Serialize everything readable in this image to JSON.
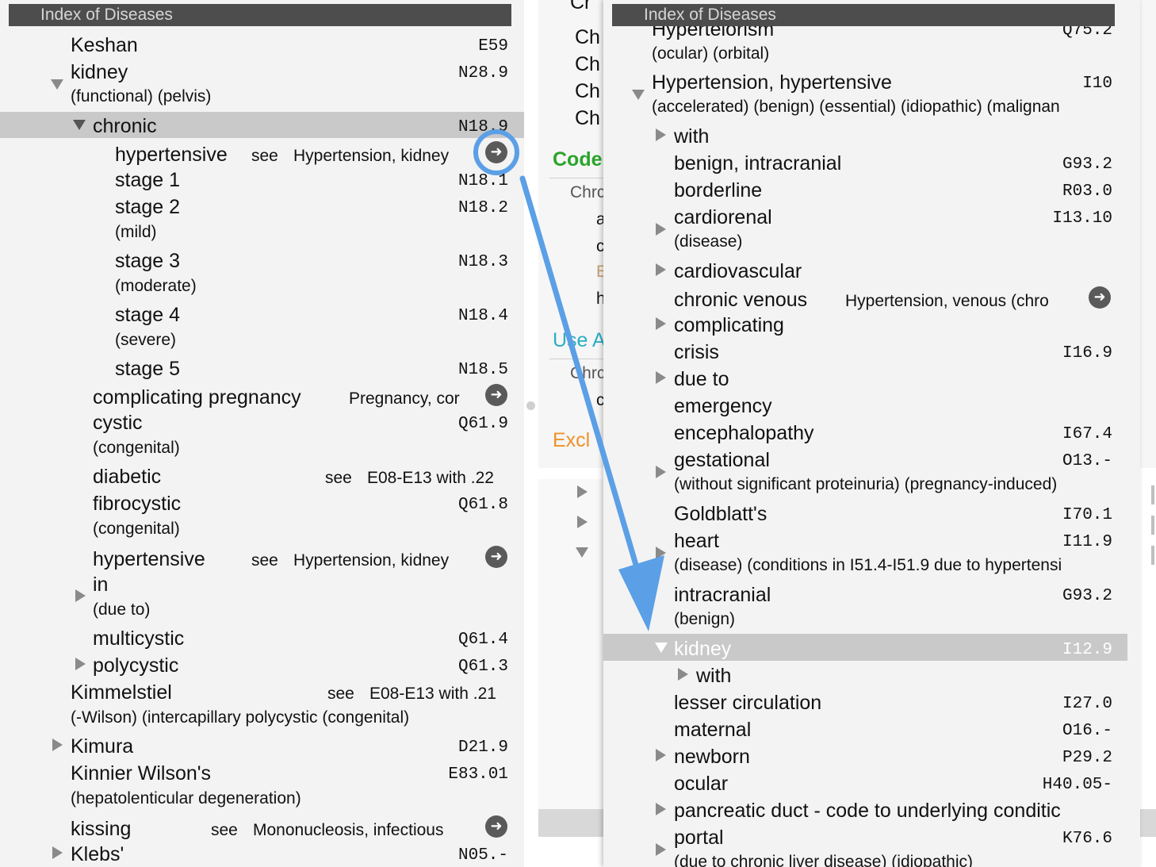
{
  "left_panel": {
    "title": "Index of Diseases",
    "rows": [
      {
        "term": "Keshan",
        "code": "E59"
      },
      {
        "term": "kidney",
        "code": "N28.9",
        "note": "(functional) (pelvis)"
      },
      {
        "term": "chronic",
        "code": "N18.9"
      },
      {
        "term": "hypertensive",
        "see": "see",
        "ref": "Hypertension, kidney"
      },
      {
        "term": "stage 1",
        "code": "N18.1"
      },
      {
        "term": "stage 2",
        "code": "N18.2",
        "note": "(mild)"
      },
      {
        "term": "stage 3",
        "code": "N18.3",
        "note": "(moderate)"
      },
      {
        "term": "stage 4",
        "code": "N18.4",
        "note": "(severe)"
      },
      {
        "term": "stage 5",
        "code": "N18.5"
      },
      {
        "term": "complicating pregnancy",
        "ref": "Pregnancy, cor"
      },
      {
        "term": "cystic",
        "code": "Q61.9",
        "note": "(congenital)"
      },
      {
        "term": "diabetic",
        "see": "see",
        "ref": "E08-E13 with .22"
      },
      {
        "term": "fibrocystic",
        "code": "Q61.8",
        "note": "(congenital)"
      },
      {
        "term": "hypertensive",
        "see": "see",
        "ref": "Hypertension, kidney"
      },
      {
        "term": "in",
        "note": "(due to)"
      },
      {
        "term": "multicystic",
        "code": "Q61.4"
      },
      {
        "term": "polycystic",
        "code": "Q61.3"
      },
      {
        "term": "Kimmelstiel",
        "see": "see",
        "ref": "E08-E13 with .21",
        "note": "(-Wilson) (intercapillary polycystic (congenital)"
      },
      {
        "term": "Kimura",
        "code": "D21.9"
      },
      {
        "term": "Kinnier Wilson's",
        "code": "E83.01",
        "note": "(hepatolenticular  degeneration)"
      },
      {
        "term": "kissing",
        "see": "see",
        "ref": "Mononucleosis, infectious"
      },
      {
        "term": "Klebs'",
        "code": "N05.-"
      }
    ]
  },
  "middle_panel": {
    "ch_items": [
      "Cr",
      "Ch",
      "Ch",
      "Ch",
      "Ch"
    ],
    "code_label": "Code",
    "chr1": "Chrc",
    "frag_a": "a",
    "frag_c": "c",
    "frag_E": "E",
    "frag_h": "h",
    "use_label": "Use A",
    "chr2": "Chrc",
    "frag_c2": "c",
    "excl_label": "Excl",
    "colors": {
      "code": "#2aa52a",
      "use": "#2aaec4",
      "excl": "#f0902a",
      "frag_E": "#c8a070"
    }
  },
  "right_panel": {
    "title": "Index of Diseases",
    "rows": [
      {
        "term": "Hypertelorism",
        "code": "Q75.2",
        "note": "(ocular) (orbital)"
      },
      {
        "term": "Hypertension, hypertensive",
        "code": "I10",
        "note": "(accelerated) (benign) (essential) (idiopathic) (malignan"
      },
      {
        "term": "with"
      },
      {
        "term": "benign, intracranial",
        "code": "G93.2"
      },
      {
        "term": "borderline",
        "code": "R03.0"
      },
      {
        "term": "cardiorenal",
        "code": "I13.10",
        "note": "(disease)"
      },
      {
        "term": "cardiovascular"
      },
      {
        "term": "chronic venous",
        "ref": "Hypertension, venous (chro"
      },
      {
        "term": "complicating"
      },
      {
        "term": "crisis",
        "code": "I16.9"
      },
      {
        "term": "due to"
      },
      {
        "term": "emergency"
      },
      {
        "term": "encephalopathy",
        "code": "I67.4"
      },
      {
        "term": "gestational",
        "code": "O13.-",
        "note": "(without significant proteinuria) (pregnancy-induced)"
      },
      {
        "term": "Goldblatt's",
        "code": "I70.1"
      },
      {
        "term": "heart",
        "code": "I11.9",
        "note": "(disease) (conditions in I51.4-I51.9 due to hypertensi"
      },
      {
        "term": "intracranial",
        "code": "G93.2",
        "note": "(benign)"
      },
      {
        "term": "kidney",
        "code": "I12.9"
      },
      {
        "term": "with"
      },
      {
        "term": "lesser circulation",
        "code": "I27.0"
      },
      {
        "term": "maternal",
        "code": "O16.-"
      },
      {
        "term": "newborn",
        "code": "P29.2"
      },
      {
        "term": "ocular",
        "code": "H40.05-"
      },
      {
        "term": "pancreatic duct - code to underlying conditic"
      },
      {
        "term": "portal",
        "code": "K76.6",
        "note": "(due to chronic liver disease) (idiopathic)"
      }
    ]
  },
  "annotation": {
    "color": "#5b9fe6",
    "label": "Drag arrow"
  }
}
